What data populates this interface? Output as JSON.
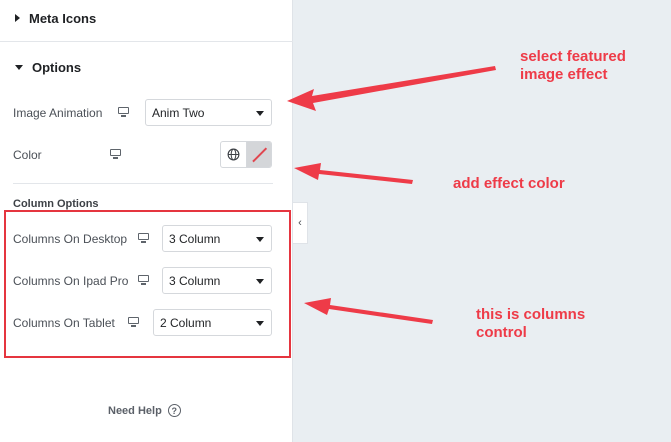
{
  "panel": {
    "sections": {
      "meta_icons": "Meta Icons",
      "options": "Options"
    },
    "controls": {
      "image_animation": {
        "label": "Image Animation",
        "value": "Anim Two",
        "device_icon": "monitor-icon"
      },
      "color": {
        "label": "Color",
        "device_icon": "monitor-icon",
        "buttons": [
          "globe-icon",
          "clear-color-icon"
        ]
      }
    },
    "column_options": {
      "title": "Column Options",
      "rows": [
        {
          "label": "Columns On Desktop",
          "value": "3 Column"
        },
        {
          "label": "Columns On Ipad Pro",
          "value": "3 Column"
        },
        {
          "label": "Columns On Tablet",
          "value": "2 Column"
        }
      ]
    },
    "help": {
      "label": "Need Help",
      "icon": "question-circle-icon"
    },
    "collapse": "‹"
  },
  "annotations": {
    "color": "#ee3b48",
    "featured": [
      "select featured",
      "image effect"
    ],
    "effect_color": "add effect color",
    "columns": [
      "this is columns",
      "control"
    ]
  }
}
